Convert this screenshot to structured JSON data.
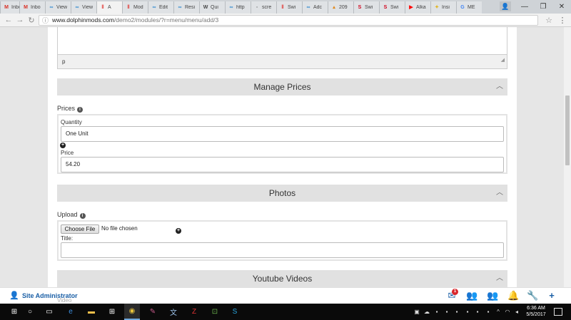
{
  "browser": {
    "tabs": [
      {
        "label": "Inbo",
        "icon": "gmail-icon",
        "glyph": "M",
        "color": "#d93025"
      },
      {
        "label": "Inbo",
        "icon": "gmail-icon",
        "glyph": "M",
        "color": "#d93025"
      },
      {
        "label": "View",
        "icon": "infinity-icon",
        "glyph": "∞",
        "color": "#3a8fd1"
      },
      {
        "label": "View",
        "icon": "infinity-icon",
        "glyph": "∞",
        "color": "#3a8fd1"
      },
      {
        "label": "A",
        "icon": "pause-icon",
        "glyph": "‖",
        "color": "#e0332e",
        "active": true
      },
      {
        "label": "Mod",
        "icon": "pause-icon",
        "glyph": "‖",
        "color": "#e0332e"
      },
      {
        "label": "Edit",
        "icon": "infinity-icon",
        "glyph": "∞",
        "color": "#3a8fd1"
      },
      {
        "label": "Resi",
        "icon": "infinity-icon",
        "glyph": "∞",
        "color": "#3a8fd1"
      },
      {
        "label": "Qui",
        "icon": "wordpress-icon",
        "glyph": "W",
        "color": "#464646"
      },
      {
        "label": "http",
        "icon": "infinity-icon",
        "glyph": "∞",
        "color": "#3a8fd1"
      },
      {
        "label": "scre",
        "icon": "document-icon",
        "glyph": "▫",
        "color": "#777777"
      },
      {
        "label": "Swi",
        "icon": "pause-icon",
        "glyph": "‖",
        "color": "#e0332e"
      },
      {
        "label": "Adc",
        "icon": "infinity-icon",
        "glyph": "∞",
        "color": "#3a8fd1"
      },
      {
        "label": "209",
        "icon": "chart-icon",
        "glyph": "▴",
        "color": "#e08a1e"
      },
      {
        "label": "Swi",
        "icon": "sf-icon",
        "glyph": "S",
        "color": "#d0021b"
      },
      {
        "label": "Swi",
        "icon": "sf-icon",
        "glyph": "S",
        "color": "#d0021b"
      },
      {
        "label": "Alka",
        "icon": "youtube-icon",
        "glyph": "▶",
        "color": "#ff0000"
      },
      {
        "label": "Insi",
        "icon": "star-icon",
        "glyph": "✦",
        "color": "#e0b41e"
      },
      {
        "label": "ME",
        "icon": "google-icon",
        "glyph": "G",
        "color": "#4285f4"
      }
    ],
    "url_host": "www.dolphinmods.com",
    "url_path": "/demo2/modules/?r=menu/menu/add/3"
  },
  "editor": {
    "status_path": "p"
  },
  "sections": {
    "prices": "Manage Prices",
    "photos": "Photos",
    "youtube": "Youtube Videos"
  },
  "prices": {
    "label": "Prices",
    "quantity_label": "Quantity",
    "quantity_value": "One Unit",
    "price_label": "Price",
    "price_value": "54.20"
  },
  "photos": {
    "upload_label": "Upload",
    "choose_file": "Choose File",
    "no_file": "No file chosen",
    "title_label": "Title:"
  },
  "peek_text": "Video",
  "admin_bar": {
    "user_name": "Site Administrator",
    "mail_badge": "1",
    "accent": "#1a5fa6"
  },
  "taskbar": {
    "time": "6:36 AM",
    "date": "5/5/2017"
  }
}
